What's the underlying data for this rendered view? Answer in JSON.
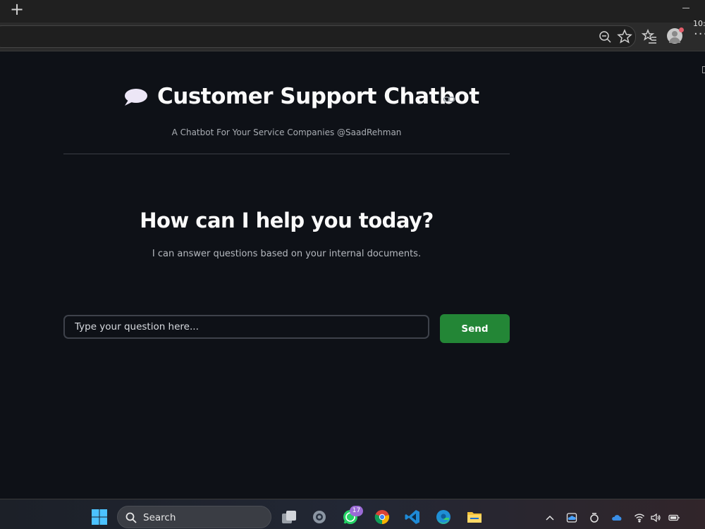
{
  "browser": {
    "new_tab_icon": "plus-icon",
    "address_bar_value": "",
    "toolbar_icons": [
      "zoom-icon",
      "favorite-star-icon",
      "favorites-list-icon",
      "profile-avatar-icon",
      "more-options-icon"
    ]
  },
  "app": {
    "title_emoji": "speech-bubble-icon",
    "title": "Customer Support Chatbot",
    "subtitle": "A Chatbot For Your Service Companies @SaadRehman",
    "help_heading": "How can I help you today?",
    "help_subtext": "I can answer questions based on your internal documents.",
    "question_input": {
      "value": "",
      "placeholder": "Type your question here..."
    },
    "send_button_label": "Send",
    "accent_color": "#238636"
  },
  "taskbar": {
    "search_label": "Search",
    "whatsapp_badge": "17",
    "apps": [
      "windows-start-icon",
      "task-view-icon",
      "settings-icon",
      "whatsapp-icon",
      "chrome-icon",
      "vscode-icon",
      "edge-icon",
      "file-explorer-icon"
    ],
    "tray": [
      "chevron-up-icon",
      "onedrive-cloud-icon",
      "sync-icon",
      "cloud-icon",
      "wifi-icon",
      "volume-icon",
      "battery-icon"
    ],
    "clock_partial": "10:"
  }
}
